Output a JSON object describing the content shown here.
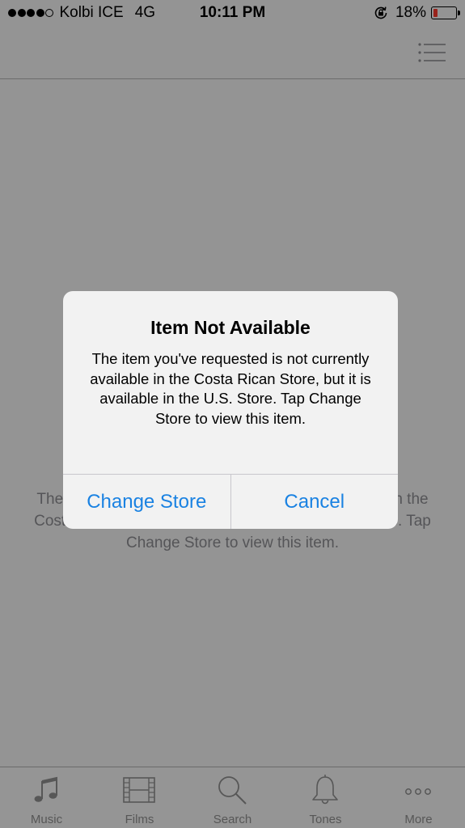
{
  "status_bar": {
    "signal_dots": [
      true,
      true,
      true,
      true,
      false
    ],
    "carrier": "Kolbi ICE",
    "network": "4G",
    "time": "10:11 PM",
    "battery_percent": "18%",
    "battery_level": 0.18,
    "battery_color": "#ff3b30"
  },
  "nav_bar": {
    "menu_icon": "list-icon"
  },
  "page": {
    "message": "The item you've requested is not currently available in the Costa Rican Store, but it is available in the U.S. Store. Tap Change Store to view this item."
  },
  "alert": {
    "title": "Item Not Available",
    "message": "The item you've requested is not currently available in the Costa Rican Store, but it is available in the U.S. Store. Tap Change Store to view this item.",
    "buttons": [
      "Change Store",
      "Cancel"
    ],
    "button_color": "#1a82e2"
  },
  "tab_bar": {
    "tabs": [
      {
        "label": "Music",
        "icon": "music-note-icon"
      },
      {
        "label": "Films",
        "icon": "film-icon"
      },
      {
        "label": "Search",
        "icon": "search-icon"
      },
      {
        "label": "Tones",
        "icon": "bell-icon"
      },
      {
        "label": "More",
        "icon": "more-icon"
      }
    ]
  }
}
